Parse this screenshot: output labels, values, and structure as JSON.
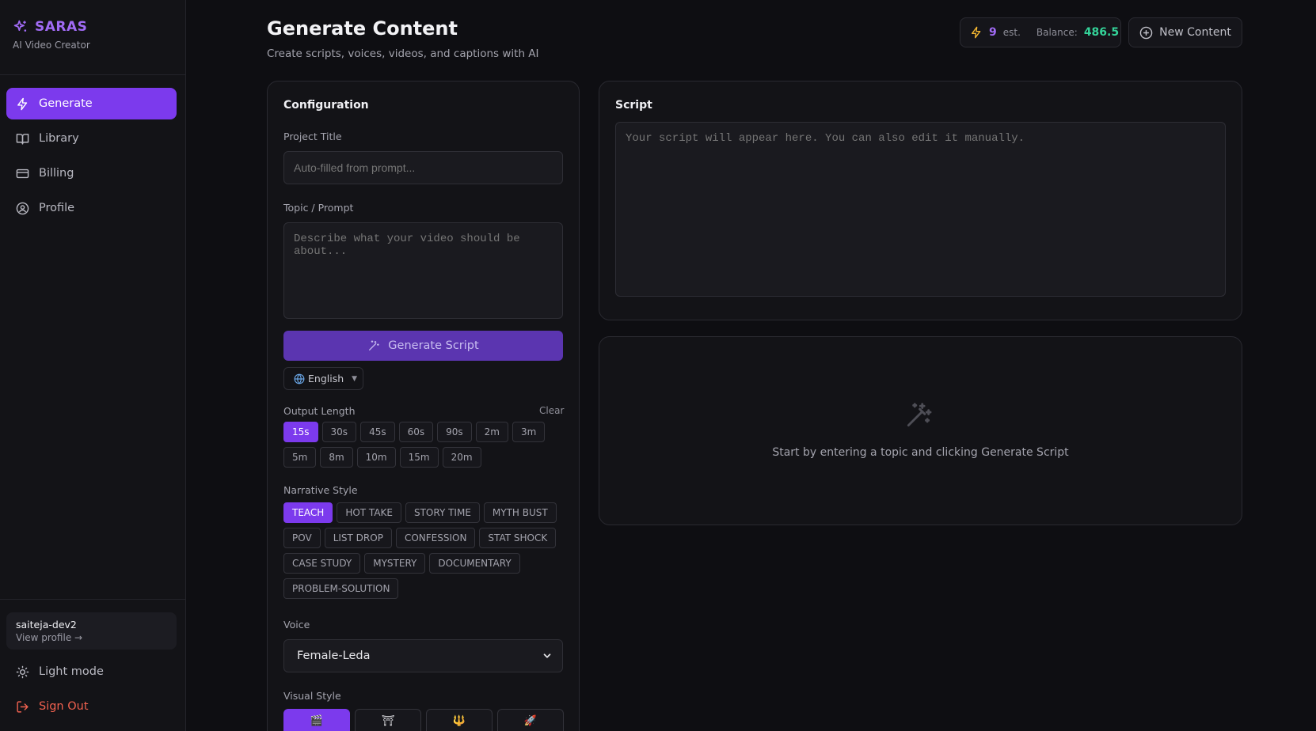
{
  "brand": {
    "name": "SARAS",
    "subtitle": "AI Video Creator"
  },
  "nav": [
    {
      "label": "Generate",
      "icon": "bolt-icon",
      "active": true
    },
    {
      "label": "Library",
      "icon": "book-icon",
      "active": false
    },
    {
      "label": "Billing",
      "icon": "card-icon",
      "active": false
    },
    {
      "label": "Profile",
      "icon": "user-icon",
      "active": false
    }
  ],
  "user": {
    "name": "saiteja-dev2",
    "link": "View profile →"
  },
  "sidebar_bottom": {
    "theme": "Light mode",
    "signout": "Sign Out"
  },
  "header": {
    "title": "Generate Content",
    "subtitle": "Create scripts, voices, videos, and captions with AI",
    "credits": "9",
    "credits_suffix": "est.",
    "balance_label": "Balance:",
    "balance_value": "486.5",
    "new_content": "New Content"
  },
  "config": {
    "title": "Configuration",
    "project_title_label": "Project Title",
    "project_title_placeholder": "Auto-filled from prompt...",
    "topic_label": "Topic / Prompt",
    "topic_placeholder": "Describe what your video should be about...",
    "generate_button": "Generate Script",
    "language": "English",
    "output_length_label": "Output Length",
    "clear": "Clear",
    "lengths_row1": [
      "15s",
      "30s",
      "45s",
      "60s",
      "90s",
      "2m",
      "3m"
    ],
    "lengths_row2": [
      "5m",
      "8m",
      "10m",
      "15m",
      "20m"
    ],
    "selected_length": "15s",
    "narrative_label": "Narrative Style",
    "narrative_rows": [
      [
        "TEACH",
        "HOT TAKE",
        "STORY TIME",
        "MYTH BUST"
      ],
      [
        "POV",
        "LIST DROP",
        "CONFESSION",
        "STAT SHOCK"
      ],
      [
        "CASE STUDY",
        "MYSTERY",
        "DOCUMENTARY"
      ],
      [
        "PROBLEM-SOLUTION"
      ]
    ],
    "selected_narrative": "TEACH",
    "voice_label": "Voice",
    "voice_value": "Female-Leda",
    "visual_style_label": "Visual Style",
    "visual_styles": [
      "🎬",
      "⛩",
      "🔱",
      "🚀"
    ]
  },
  "script": {
    "title": "Script",
    "placeholder": "Your script will appear here. You can also edit it manually."
  },
  "empty_state": {
    "text": "Start by entering a topic and clicking Generate Script",
    "icon": "magic-wand-icon"
  },
  "colors": {
    "accent": "#7c3aed",
    "brand": "#a16bf5",
    "balance": "#34d399",
    "signout": "#f0614f"
  }
}
